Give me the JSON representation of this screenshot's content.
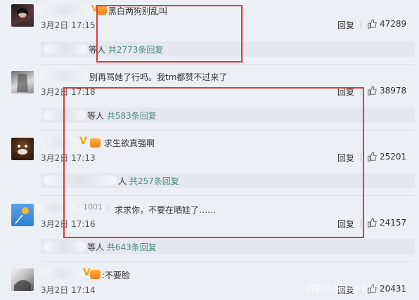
{
  "reply_label": "回复",
  "comments": [
    {
      "text": "黑白两狗别乱叫",
      "time": "3月2日 17:15",
      "likes": "47289",
      "replies_prefix": "等人",
      "replies_count": "共2773条回复"
    },
    {
      "text": "别再骂她了行吗。我tm都赞不过来了",
      "time": "3月2日 17:18",
      "likes": "38978",
      "replies_prefix": "等人",
      "replies_count": "共583条回复"
    },
    {
      "text": "求生欲真强啊",
      "time": "3月2日 17:13",
      "likes": "25201",
      "replies_prefix": "人",
      "replies_count": "共257条回复"
    },
    {
      "text": "求求你，不要在晒娃了……",
      "time": "3月2日 17:16",
      "likes": "24157",
      "replies_prefix": "等人",
      "replies_count": "共643条回复"
    },
    {
      "text": ":不要脸",
      "time": "3月2日 17:14",
      "likes": "20431",
      "replies_prefix": "",
      "replies_count": ""
    }
  ],
  "name_fragment_4": "1001",
  "watermark": "百家号/娱乐小乐谈",
  "colors": {
    "background": "#eceff4",
    "reply_count": "#4e8b78",
    "highlight_box": "#e0393e"
  }
}
